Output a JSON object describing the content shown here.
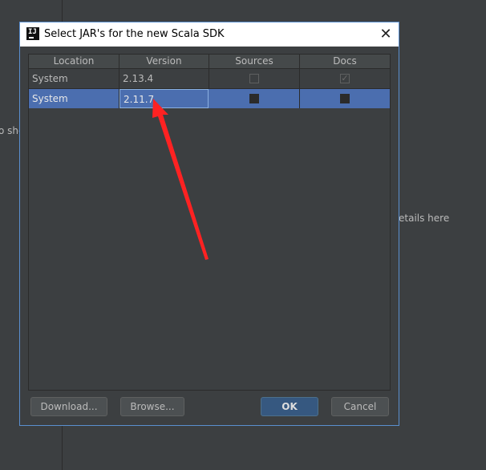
{
  "background": {
    "left_snippet": "o she",
    "right_snippet": "etails here"
  },
  "dialog": {
    "title": "Select JAR's for the new Scala SDK",
    "app_icon": "intellij-icon",
    "app_icon_text": "IJ",
    "close_glyph": "✕"
  },
  "table": {
    "columns": [
      "Location",
      "Version",
      "Sources",
      "Docs"
    ],
    "rows": [
      {
        "location": "System",
        "version": "2.13.4",
        "sources": false,
        "docs": true,
        "selected": false
      },
      {
        "location": "System",
        "version": "2.11.7",
        "sources": false,
        "docs": false,
        "selected": true
      }
    ]
  },
  "annotation": {
    "type": "red-arrow",
    "color": "#ff2222"
  },
  "buttons": {
    "download": "Download...",
    "browse": "Browse...",
    "ok": "OK",
    "cancel": "Cancel"
  },
  "colors": {
    "selection": "#4b6eaf",
    "primary_button": "#365880",
    "dialog_border": "#5a8fcf"
  }
}
